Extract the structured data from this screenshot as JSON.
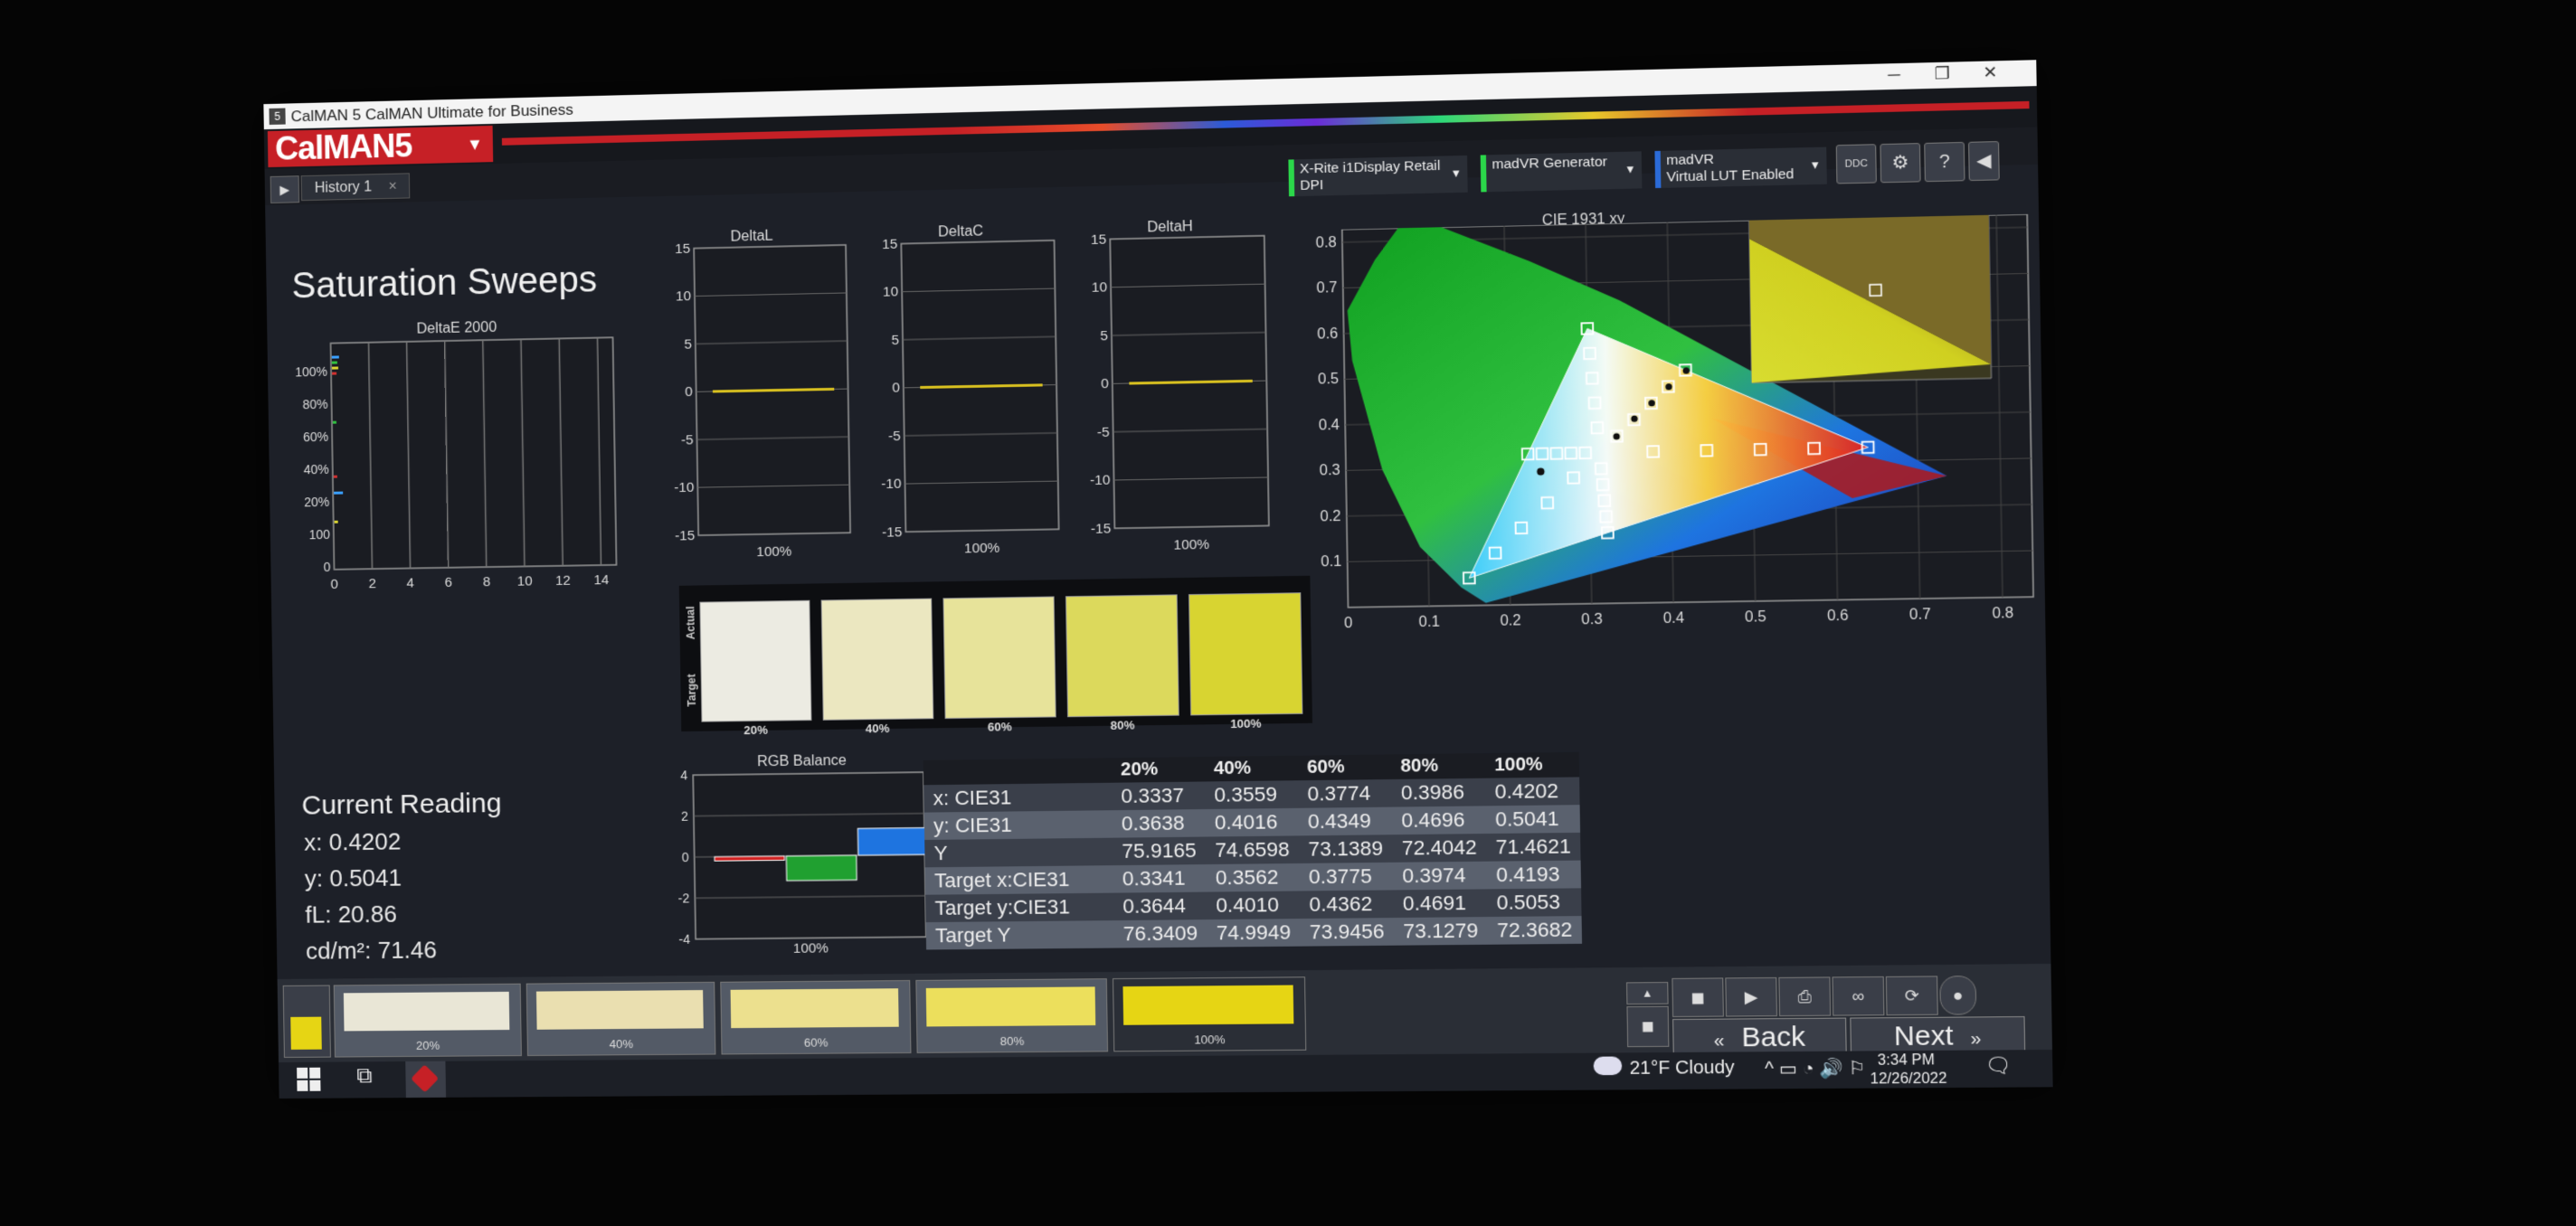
{
  "window": {
    "title": "CalMAN 5 CalMAN Ultimate for Business",
    "minimize": "─",
    "maximize": "❐",
    "close": "✕"
  },
  "brand": {
    "logo": "CalMAN5"
  },
  "history": {
    "tab_label": "History 1",
    "tab_close": "×"
  },
  "devices": [
    {
      "line1": "X-Rite i1Display Retail",
      "line2": "DPI"
    },
    {
      "line1": "madVR Generator",
      "line2": ""
    },
    {
      "line1": "madVR",
      "line2": "Virtual LUT Enabled"
    }
  ],
  "toolbar": {
    "ddc_label": "DDC",
    "settings": "⚙",
    "help": "?",
    "collapse": "◀"
  },
  "page": {
    "title": "Saturation Sweeps"
  },
  "deltae": {
    "title": "DeltaE 2000",
    "y_labels": [
      "100%",
      "80%",
      "60%",
      "40%",
      "20%",
      "100",
      "0"
    ],
    "x_labels": [
      "0",
      "2",
      "4",
      "6",
      "8",
      "10",
      "12",
      "14"
    ]
  },
  "small_charts": [
    {
      "title": "DeltaL",
      "y_labels": [
        "15",
        "10",
        "5",
        "0",
        "-5",
        "-10",
        "-15"
      ],
      "x_label": "100%",
      "value": 0
    },
    {
      "title": "DeltaC",
      "y_labels": [
        "15",
        "10",
        "5",
        "0",
        "-5",
        "-10",
        "-15"
      ],
      "x_label": "100%",
      "value": 0
    },
    {
      "title": "DeltaH",
      "y_labels": [
        "15",
        "10",
        "5",
        "0",
        "-5",
        "-10",
        "-15"
      ],
      "x_label": "100%",
      "value": 0
    }
  ],
  "patches": {
    "label_actual": "Actual",
    "label_target": "Target",
    "items": [
      {
        "label": "20%",
        "color": "#ecebe2"
      },
      {
        "label": "40%",
        "color": "#ebe7c0"
      },
      {
        "label": "60%",
        "color": "#e7e39a"
      },
      {
        "label": "80%",
        "color": "#dcd95c"
      },
      {
        "label": "100%",
        "color": "#d8d431"
      }
    ]
  },
  "cie": {
    "title": "CIE 1931 xy",
    "x_labels": [
      "0",
      "0.1",
      "0.2",
      "0.3",
      "0.4",
      "0.5",
      "0.6",
      "0.7",
      "0.8"
    ],
    "y_labels": [
      "0.8",
      "0.7",
      "0.6",
      "0.5",
      "0.4",
      "0.3",
      "0.2",
      "0.1"
    ]
  },
  "chart_data": [
    {
      "type": "scatter",
      "title": "CIE 1931 xy",
      "xlim": [
        0,
        0.8
      ],
      "ylim": [
        0,
        0.8
      ],
      "gamut_triangle": {
        "x": [
          0.64,
          0.3,
          0.15
        ],
        "y": [
          0.33,
          0.6,
          0.06
        ]
      },
      "white_point": {
        "x": 0.3127,
        "y": 0.329
      },
      "series": [
        {
          "x": [
            0.3337,
            0.3559,
            0.3774,
            0.3986,
            0.4202
          ],
          "y": [
            0.3638,
            0.4016,
            0.4349,
            0.4696,
            0.5041
          ]
        },
        {
          "x": [
            0.3341,
            0.3562,
            0.3775,
            0.3974,
            0.4193
          ],
          "y": [
            0.3644,
            0.401,
            0.4362,
            0.4691,
            0.5053
          ]
        }
      ]
    },
    {
      "type": "bar",
      "title": "RGB Balance",
      "categories": [
        "R",
        "G",
        "B"
      ],
      "values": [
        -0.2,
        -1.2,
        1.3
      ],
      "colors": [
        "#d02020",
        "#20a030",
        "#1e74e0"
      ],
      "ylim": [
        -4,
        4
      ],
      "y_labels": [
        "4",
        "2",
        "0",
        "-2",
        "-4"
      ],
      "x_label": "100%"
    }
  ],
  "current": {
    "title": "Current Reading",
    "x": "x: 0.4202",
    "y": "y: 0.5041",
    "fl": "fL: 20.86",
    "cdm2": "cd/m²: 71.46"
  },
  "table": {
    "headers": [
      "",
      "20%",
      "40%",
      "60%",
      "80%",
      "100%"
    ],
    "rows": [
      [
        "x: CIE31",
        "0.3337",
        "0.3559",
        "0.3774",
        "0.3986",
        "0.4202"
      ],
      [
        "y: CIE31",
        "0.3638",
        "0.4016",
        "0.4349",
        "0.4696",
        "0.5041"
      ],
      [
        "Y",
        "75.9165",
        "74.6598",
        "73.1389",
        "72.4042",
        "71.4621"
      ],
      [
        "Target x:CIE31",
        "0.3341",
        "0.3562",
        "0.3775",
        "0.3974",
        "0.4193"
      ],
      [
        "Target y:CIE31",
        "0.3644",
        "0.4010",
        "0.4362",
        "0.4691",
        "0.5053"
      ],
      [
        "Target Y",
        "76.3409",
        "74.9949",
        "73.9456",
        "73.1279",
        "72.3682"
      ]
    ]
  },
  "swatches": [
    {
      "label": "20%",
      "color": "#e9e6d6"
    },
    {
      "label": "40%",
      "color": "#eadfb0"
    },
    {
      "label": "60%",
      "color": "#ece08e"
    },
    {
      "label": "80%",
      "color": "#ecdf5c"
    },
    {
      "label": "100%",
      "color": "#e6d514"
    }
  ],
  "nav": {
    "back": "Back",
    "next": "Next"
  },
  "tray": {
    "weather": "21°F  Cloudy",
    "time": "3:34 PM",
    "date": "12/26/2022"
  }
}
